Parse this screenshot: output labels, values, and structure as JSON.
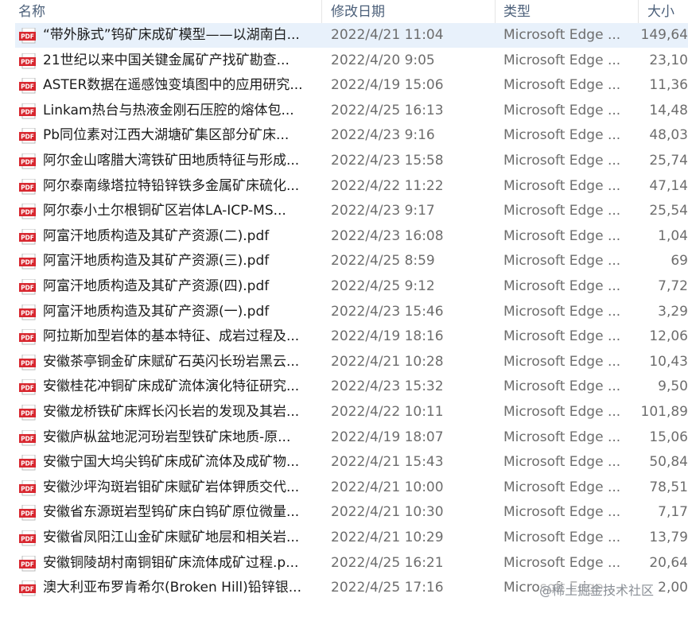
{
  "columns": {
    "name": "名称",
    "date": "修改日期",
    "type": "类型",
    "size": "大小"
  },
  "files": [
    {
      "name": "“带外脉式”钨矿床成矿模型——以湖南白...",
      "date": "2022/4/21 11:04",
      "type": "Microsoft Edge ...",
      "size": "149,64",
      "selected": true
    },
    {
      "name": "21世纪以来中国关键金属矿产找矿勘查...",
      "date": "2022/4/20 9:05",
      "type": "Microsoft Edge ...",
      "size": "23,10"
    },
    {
      "name": "ASTER数据在遥感蚀变填图中的应用研究...",
      "date": "2022/4/19 15:06",
      "type": "Microsoft Edge ...",
      "size": "11,36"
    },
    {
      "name": "Linkam热台与热液金刚石压腔的熔体包...",
      "date": "2022/4/25 16:13",
      "type": "Microsoft Edge ...",
      "size": "14,48"
    },
    {
      "name": "Pb同位素对江西大湖塘矿集区部分矿床...",
      "date": "2022/4/23 9:16",
      "type": "Microsoft Edge ...",
      "size": "48,03"
    },
    {
      "name": "阿尔金山喀腊大湾铁矿田地质特征与形成...",
      "date": "2022/4/23 15:58",
      "type": "Microsoft Edge ...",
      "size": "25,74"
    },
    {
      "name": "阿尔泰南缘塔拉特铅锌铁多金属矿床硫化...",
      "date": "2022/4/22 11:22",
      "type": "Microsoft Edge ...",
      "size": "47,14"
    },
    {
      "name": "阿尔泰小土尔根铜矿区岩体LA-ICP-MS...",
      "date": "2022/4/23 9:17",
      "type": "Microsoft Edge ...",
      "size": "25,54"
    },
    {
      "name": "阿富汗地质构造及其矿产资源(二).pdf",
      "date": "2022/4/23 16:08",
      "type": "Microsoft Edge ...",
      "size": "1,04"
    },
    {
      "name": "阿富汗地质构造及其矿产资源(三).pdf",
      "date": "2022/4/25 8:59",
      "type": "Microsoft Edge ...",
      "size": "69"
    },
    {
      "name": "阿富汗地质构造及其矿产资源(四).pdf",
      "date": "2022/4/25 9:12",
      "type": "Microsoft Edge ...",
      "size": "7,72"
    },
    {
      "name": "阿富汗地质构造及其矿产资源(一).pdf",
      "date": "2022/4/23 15:46",
      "type": "Microsoft Edge ...",
      "size": "3,29"
    },
    {
      "name": "阿拉斯加型岩体的基本特征、成岩过程及...",
      "date": "2022/4/19 18:16",
      "type": "Microsoft Edge ...",
      "size": "12,06"
    },
    {
      "name": "安徽茶亭铜金矿床赋矿石英闪长玢岩黑云...",
      "date": "2022/4/21 10:28",
      "type": "Microsoft Edge ...",
      "size": "10,43"
    },
    {
      "name": "安徽桂花冲铜矿床成矿流体演化特征研究...",
      "date": "2022/4/23 15:32",
      "type": "Microsoft Edge ...",
      "size": "9,50"
    },
    {
      "name": "安徽龙桥铁矿床辉长闪长岩的发现及其岩...",
      "date": "2022/4/22 10:11",
      "type": "Microsoft Edge ...",
      "size": "101,89"
    },
    {
      "name": "安徽庐枞盆地泥河玢岩型铁矿床地质-原...",
      "date": "2022/4/19 18:07",
      "type": "Microsoft Edge ...",
      "size": "15,06"
    },
    {
      "name": "安徽宁国大坞尖钨矿床成矿流体及成矿物...",
      "date": "2022/4/21 15:43",
      "type": "Microsoft Edge ...",
      "size": "50,84"
    },
    {
      "name": "安徽沙坪沟斑岩钼矿床赋矿岩体钾质交代...",
      "date": "2022/4/21 10:00",
      "type": "Microsoft Edge ...",
      "size": "78,51"
    },
    {
      "name": "安徽省东源斑岩型钨矿床白钨矿原位微量...",
      "date": "2022/4/21 10:30",
      "type": "Microsoft Edge ...",
      "size": "7,17"
    },
    {
      "name": "安徽省凤阳江山金矿床赋矿地层和相关岩...",
      "date": "2022/4/21 10:29",
      "type": "Microsoft Edge ...",
      "size": "13,79"
    },
    {
      "name": "安徽铜陵胡村南铜钼矿床流体成矿过程.p...",
      "date": "2022/4/25 16:21",
      "type": "Microsoft Edge ...",
      "size": "20,64"
    },
    {
      "name": "澳大利亚布罗肯希尔(Broken Hill)铅锌银...",
      "date": "2022/4/25 17:16",
      "type": "Microsoft Edge ...",
      "size": "2,00"
    }
  ],
  "watermark": "@稀土掘金技术社区",
  "icon": "pdf-file-icon",
  "colors": {
    "selected_row": "#e8f1fb",
    "pdf_red": "#d8272f",
    "header_text": "#4c607a"
  }
}
